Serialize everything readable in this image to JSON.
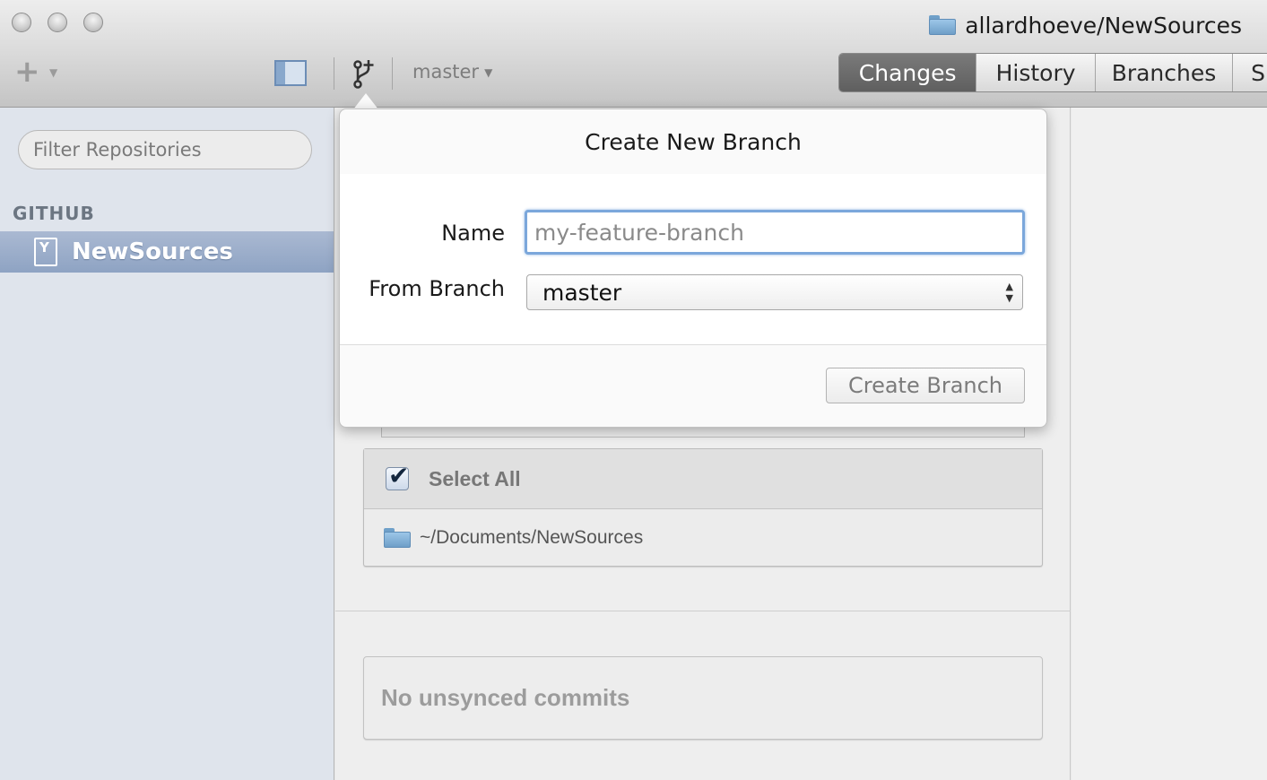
{
  "window": {
    "repo_title": "allardhoeve/NewSources",
    "traffic_lights": [
      "close",
      "minimize",
      "zoom"
    ]
  },
  "toolbar": {
    "add_icon": "plus-icon",
    "branch_icon": "branch-icon",
    "current_branch": "master",
    "tabs": [
      {
        "label": "Changes",
        "active": true
      },
      {
        "label": "History",
        "active": false
      },
      {
        "label": "Branches",
        "active": false
      },
      {
        "label": "S",
        "active": false
      }
    ]
  },
  "sidebar": {
    "filter_placeholder": "Filter Repositories",
    "section_header": "GITHUB",
    "repos": [
      {
        "name": "NewSources",
        "selected": true
      }
    ]
  },
  "main": {
    "select_all_label": "Select All",
    "select_all_checked": true,
    "file_path": "~/Documents/NewSources",
    "unsynced_label": "No unsynced commits"
  },
  "popover": {
    "title": "Create New Branch",
    "name_label": "Name",
    "name_placeholder": "my-feature-branch",
    "from_label": "From Branch",
    "from_value": "master",
    "create_button": "Create Branch"
  },
  "colors": {
    "sidebar_bg": "#dfe4ec",
    "selection": "#9aadca",
    "focus_ring": "#7ba7db",
    "active_tab": "#6b6b6b"
  }
}
